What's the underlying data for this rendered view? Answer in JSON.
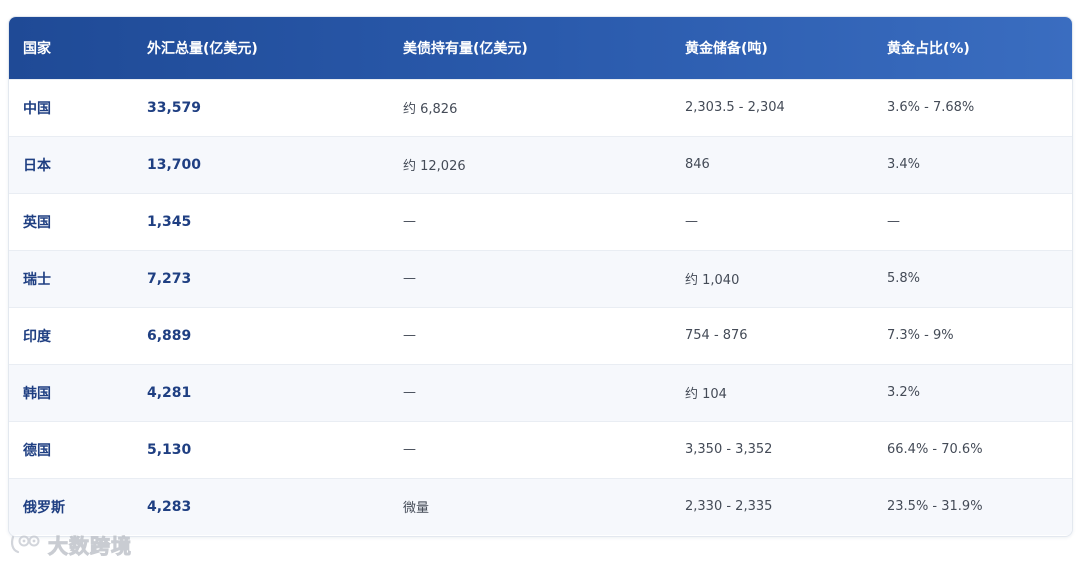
{
  "table": {
    "headers": [
      "国家",
      "外汇总量(亿美元)",
      "美债持有量(亿美元)",
      "黄金储备(吨)",
      "黄金占比(%)"
    ],
    "rows": [
      {
        "country": "中国",
        "fx": "33,579",
        "treasury": "约 6,826",
        "gold": "2,303.5 - 2,304",
        "ratio": "3.6% - 7.68%"
      },
      {
        "country": "日本",
        "fx": "13,700",
        "treasury": "约 12,026",
        "gold": "846",
        "ratio": "3.4%"
      },
      {
        "country": "英国",
        "fx": "1,345",
        "treasury": "—",
        "gold": "—",
        "ratio": "—"
      },
      {
        "country": "瑞士",
        "fx": "7,273",
        "treasury": "—",
        "gold": "约 1,040",
        "ratio": "5.8%"
      },
      {
        "country": "印度",
        "fx": "6,889",
        "treasury": "—",
        "gold": "754 - 876",
        "ratio": "7.3% - 9%"
      },
      {
        "country": "韩国",
        "fx": "4,281",
        "treasury": "—",
        "gold": "约 104",
        "ratio": "3.2%"
      },
      {
        "country": "德国",
        "fx": "5,130",
        "treasury": "—",
        "gold": "3,350 - 3,352",
        "ratio": "66.4% - 70.6%"
      },
      {
        "country": "俄罗斯",
        "fx": "4,283",
        "treasury": "微量",
        "gold": "2,330 - 2,335",
        "ratio": "23.5% - 31.9%"
      }
    ]
  },
  "watermark": {
    "text": "大数跨境"
  },
  "colors": {
    "header_start": "#1f4a96",
    "header_end": "#3a6dc0",
    "accent_text": "#1f3f82",
    "stripe": "#f6f8fc"
  }
}
